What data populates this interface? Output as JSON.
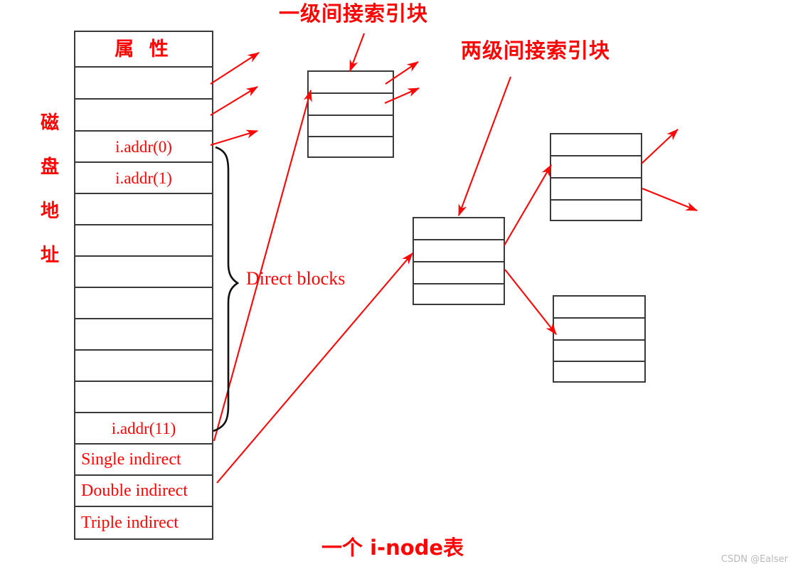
{
  "diagram": {
    "title_caption": "一个 i-node表",
    "caption_parts": {
      "prefix": "一个 ",
      "mono": "i-node",
      "suffix": "表"
    },
    "watermark": "CSDN @Ealser",
    "accent_color": "#fb0505",
    "line_color": "#3a3a3a",
    "background": "#ffffff"
  },
  "labels": {
    "first_level_indirect": "一级间接索引块",
    "second_level_indirect": "两级间接索引块",
    "direct_blocks": "Direct blocks",
    "disk_address_vertical": [
      "磁",
      "盘",
      "地",
      "址"
    ]
  },
  "inode_table": {
    "name": "一个 i-node表",
    "header": "属 性",
    "rows": [
      {
        "label": "属 性",
        "kind": "header"
      },
      {
        "label": "",
        "kind": "blank"
      },
      {
        "label": "",
        "kind": "blank"
      },
      {
        "label": "i.addr(0)",
        "kind": "direct"
      },
      {
        "label": "i.addr(1)",
        "kind": "direct"
      },
      {
        "label": "",
        "kind": "blank"
      },
      {
        "label": "",
        "kind": "blank"
      },
      {
        "label": "",
        "kind": "blank"
      },
      {
        "label": "",
        "kind": "blank"
      },
      {
        "label": "",
        "kind": "blank"
      },
      {
        "label": "",
        "kind": "blank"
      },
      {
        "label": "",
        "kind": "blank"
      },
      {
        "label": "i.addr(11)",
        "kind": "direct"
      },
      {
        "label": "Single indirect",
        "kind": "indirect"
      },
      {
        "label": "Double indirect",
        "kind": "indirect"
      },
      {
        "label": "Triple indirect",
        "kind": "indirect"
      }
    ]
  },
  "index_blocks": [
    {
      "id": "blk-single",
      "name": "一级间接索引块",
      "rows": 4
    },
    {
      "id": "blk-double",
      "name": "两级间接索引块（一级）",
      "rows": 4
    },
    {
      "id": "blk-tr-top",
      "name": "两级间接索引块（二级·上）",
      "rows": 4
    },
    {
      "id": "blk-tr-bot",
      "name": "两级间接索引块（二级·下）",
      "rows": 4
    }
  ]
}
